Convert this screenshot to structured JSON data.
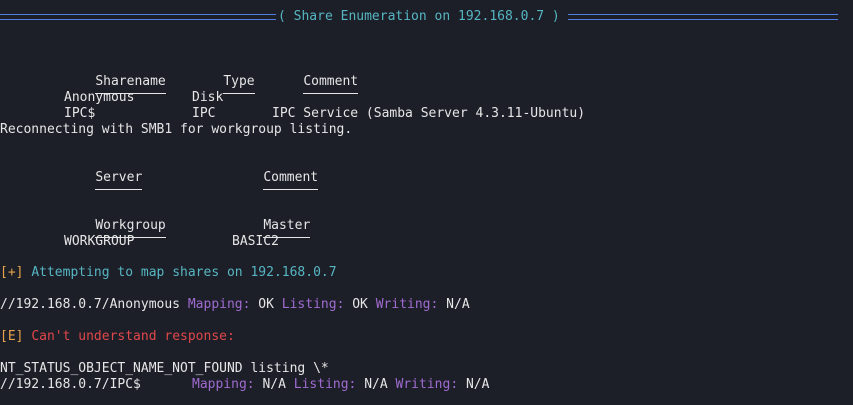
{
  "header": {
    "title": "( Share Enumeration on 192.168.0.7 )"
  },
  "shares_table": {
    "columns": [
      "Sharename",
      "Type",
      "Comment"
    ],
    "rows": [
      {
        "name": "Anonymous",
        "type": "Disk",
        "comment": ""
      },
      {
        "name": "IPC$",
        "type": "IPC",
        "comment": "IPC Service (Samba Server 4.3.11-Ubuntu)"
      }
    ]
  },
  "reconnect_msg": "Reconnecting with SMB1 for workgroup listing.",
  "server_table": {
    "columns": [
      "Server",
      "Comment"
    ]
  },
  "workgroup_table": {
    "columns": [
      "Workgroup",
      "Master"
    ],
    "rows": [
      {
        "workgroup": "WORKGROUP",
        "master": "BASIC2"
      }
    ]
  },
  "map_attempt": {
    "prefix": "[+]",
    "text": "Attempting to map shares on 192.168.0.7"
  },
  "anon_result": {
    "path": "//192.168.0.7/Anonymous",
    "mapping_label": "Mapping:",
    "mapping_value": "OK",
    "listing_label": "Listing:",
    "listing_value": "OK",
    "writing_label": "Writing:",
    "writing_value": "N/A"
  },
  "error": {
    "prefix": "[E]",
    "text": "Can't understand response:"
  },
  "nt_status": "NT_STATUS_OBJECT_NAME_NOT_FOUND listing \\*",
  "ipc_result": {
    "path": "//192.168.0.7/IPC$",
    "mapping_label": "Mapping:",
    "mapping_value": "N/A",
    "listing_label": "Listing:",
    "listing_value": "N/A",
    "writing_label": "Writing:",
    "writing_value": "N/A"
  },
  "colors": {
    "background": "#1c1e28",
    "text": "#e6e6e6",
    "cyan": "#56b6c2",
    "orange": "#e6a44a",
    "purple": "#a06bd0",
    "red": "#e0484a",
    "rule": "#4f7fe0"
  }
}
